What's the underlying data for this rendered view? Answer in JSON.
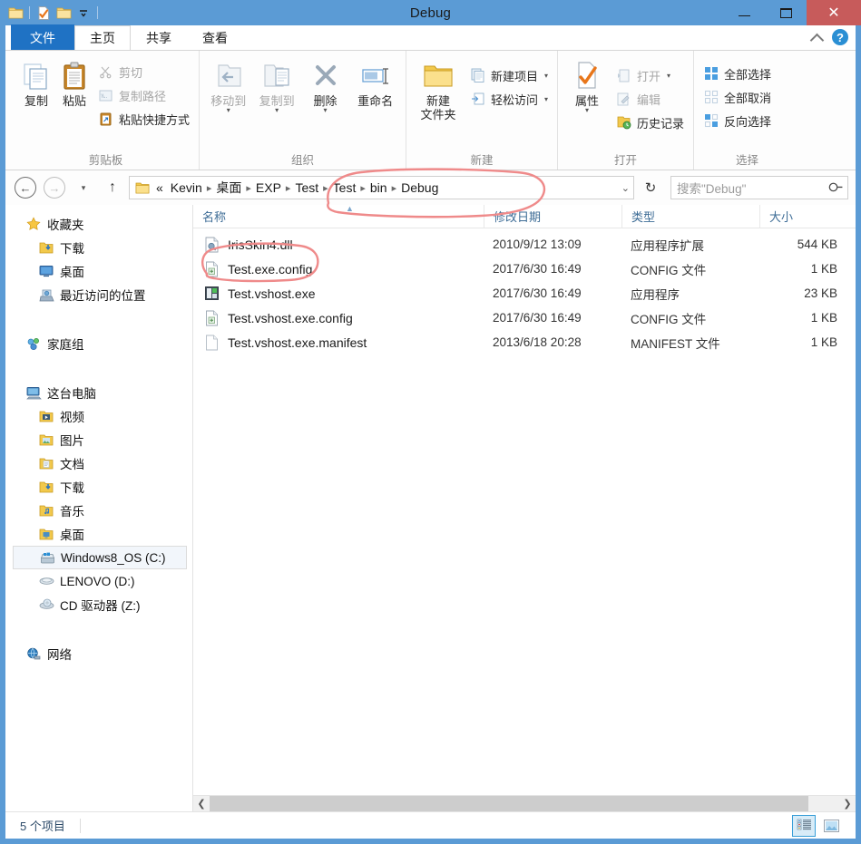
{
  "window": {
    "title": "Debug",
    "minimize_label": "最小化",
    "maximize_label": "最大化",
    "close_label": "✕"
  },
  "quick_access": {
    "icons": [
      "folder-icon",
      "properties-icon",
      "new-folder-icon",
      "chevron-down-icon"
    ]
  },
  "tabs": [
    {
      "label": "文件",
      "name": "tab-file"
    },
    {
      "label": "主页",
      "name": "tab-home"
    },
    {
      "label": "共享",
      "name": "tab-share"
    },
    {
      "label": "查看",
      "name": "tab-view"
    }
  ],
  "ribbon": {
    "groups": [
      {
        "label": "剪贴板",
        "big": [
          {
            "label": "复制",
            "icon": "copy-icon",
            "dim": false
          },
          {
            "label": "粘贴",
            "icon": "paste-icon",
            "dim": false
          }
        ],
        "small": [
          {
            "label": "剪切",
            "icon": "scissors-icon",
            "dim": true
          },
          {
            "label": "复制路径",
            "icon": "copy-path-icon",
            "dim": true
          },
          {
            "label": "粘贴快捷方式",
            "icon": "paste-shortcut-icon",
            "dim": false
          }
        ]
      },
      {
        "label": "组织",
        "big": [
          {
            "label": "移动到",
            "icon": "move-to-icon",
            "dim": true,
            "caret": true
          },
          {
            "label": "复制到",
            "icon": "copy-to-icon",
            "dim": true,
            "caret": true
          },
          {
            "label": "删除",
            "icon": "delete-x-icon",
            "dim": false,
            "caret": true
          },
          {
            "label": "重命名",
            "icon": "rename-icon",
            "dim": false
          }
        ],
        "small": []
      },
      {
        "label": "新建",
        "big": [
          {
            "label": "新建\n文件夹",
            "icon": "new-folder-icon",
            "dim": false
          }
        ],
        "small": [
          {
            "label": "新建项目",
            "icon": "new-item-icon",
            "dim": false,
            "arrow": true
          },
          {
            "label": "轻松访问",
            "icon": "easy-access-icon",
            "dim": false,
            "arrow": true
          }
        ]
      },
      {
        "label": "打开",
        "big": [
          {
            "label": "属性",
            "icon": "properties-icon",
            "dim": false,
            "caret": true
          }
        ],
        "small": [
          {
            "label": "打开",
            "icon": "open-icon",
            "dim": true,
            "arrow": true
          },
          {
            "label": "编辑",
            "icon": "edit-icon",
            "dim": true
          },
          {
            "label": "历史记录",
            "icon": "history-icon",
            "dim": false
          }
        ]
      },
      {
        "label": "选择",
        "big": [],
        "small": [
          {
            "label": "全部选择",
            "icon": "select-all-icon",
            "dim": false
          },
          {
            "label": "全部取消",
            "icon": "select-none-icon",
            "dim": false
          },
          {
            "label": "反向选择",
            "icon": "invert-selection-icon",
            "dim": false
          }
        ]
      }
    ],
    "collapse_icon": "chevron-up-icon",
    "help_icon": "help-icon",
    "help_label": "?"
  },
  "address_bar": {
    "back_label": "←",
    "forward_label": "→",
    "recent_caret": "▾",
    "up_label": "↑",
    "folder_icon": "folder-icon",
    "overflow": "«",
    "crumbs": [
      "Kevin",
      "桌面",
      "EXP",
      "Test",
      "Test",
      "bin",
      "Debug"
    ],
    "separator": "▸",
    "dropdown_caret": "⌄",
    "refresh_label": "↻",
    "search_placeholder": "搜索\"Debug\"",
    "search_value": "",
    "search_icon": "search-icon"
  },
  "nav_pane": {
    "sections": [
      {
        "header": {
          "label": "收藏夹",
          "icon": "star-icon"
        },
        "items": [
          {
            "label": "下载",
            "icon": "downloads-folder-icon"
          },
          {
            "label": "桌面",
            "icon": "desktop-icon"
          },
          {
            "label": "最近访问的位置",
            "icon": "recent-places-icon"
          }
        ]
      },
      {
        "header": {
          "label": "家庭组",
          "icon": "homegroup-icon"
        },
        "items": []
      },
      {
        "header": {
          "label": "这台电脑",
          "icon": "this-pc-icon"
        },
        "items": [
          {
            "label": "视频",
            "icon": "videos-folder-icon"
          },
          {
            "label": "图片",
            "icon": "pictures-folder-icon"
          },
          {
            "label": "文档",
            "icon": "documents-folder-icon"
          },
          {
            "label": "下载",
            "icon": "downloads-folder-icon"
          },
          {
            "label": "音乐",
            "icon": "music-folder-icon"
          },
          {
            "label": "桌面",
            "icon": "desktop-folder-icon"
          },
          {
            "label": "Windows8_OS (C:)",
            "icon": "windows-drive-icon",
            "selected": true
          },
          {
            "label": "LENOVO (D:)",
            "icon": "drive-icon"
          },
          {
            "label": "CD 驱动器 (Z:)",
            "icon": "cd-drive-icon"
          }
        ]
      },
      {
        "header": {
          "label": "网络",
          "icon": "network-icon"
        },
        "items": []
      }
    ]
  },
  "file_list": {
    "columns": [
      "名称",
      "修改日期",
      "类型",
      "大小"
    ],
    "sort_column": "名称",
    "sort_direction": "asc",
    "rows": [
      {
        "name": "IrisSkin4.dll",
        "date": "2010/9/12 13:09",
        "type": "应用程序扩展",
        "size": "544 KB",
        "icon": "dll-file-icon"
      },
      {
        "name": "Test.exe.config",
        "date": "2017/6/30 16:49",
        "type": "CONFIG 文件",
        "size": "1 KB",
        "icon": "config-file-icon"
      },
      {
        "name": "Test.vshost.exe",
        "date": "2017/6/30 16:49",
        "type": "应用程序",
        "size": "23 KB",
        "icon": "exe-file-icon"
      },
      {
        "name": "Test.vshost.exe.config",
        "date": "2017/6/30 16:49",
        "type": "CONFIG 文件",
        "size": "1 KB",
        "icon": "config-file-icon"
      },
      {
        "name": "Test.vshost.exe.manifest",
        "date": "2013/6/18 20:28",
        "type": "MANIFEST 文件",
        "size": "1 KB",
        "icon": "blank-file-icon"
      }
    ]
  },
  "hscrollbar": {
    "left_arrow": "❮",
    "right_arrow": "❯"
  },
  "status_bar": {
    "item_count_text": "5 个项目",
    "views": [
      {
        "name": "details-view-button",
        "icon": "details-view-icon",
        "active": true
      },
      {
        "name": "large-icons-view-button",
        "icon": "large-icons-view-icon",
        "active": false
      }
    ]
  },
  "annotations": {
    "color": "#ef8a8a",
    "marks": [
      {
        "name": "breadcrumb-highlight-circle",
        "target": "Test ▸ Test ▸ bin ▸ Debug"
      },
      {
        "name": "file-highlight-circle",
        "target": "IrisSkin4.dll"
      }
    ]
  },
  "colors": {
    "titlebar": "#5b9bd5",
    "file_tab": "#1f72c4",
    "close_button": "#c75b5b",
    "column_header_text": "#3d6c96",
    "annotation_red": "#ef8a8a",
    "selection_blue": "#3a9fd8"
  }
}
